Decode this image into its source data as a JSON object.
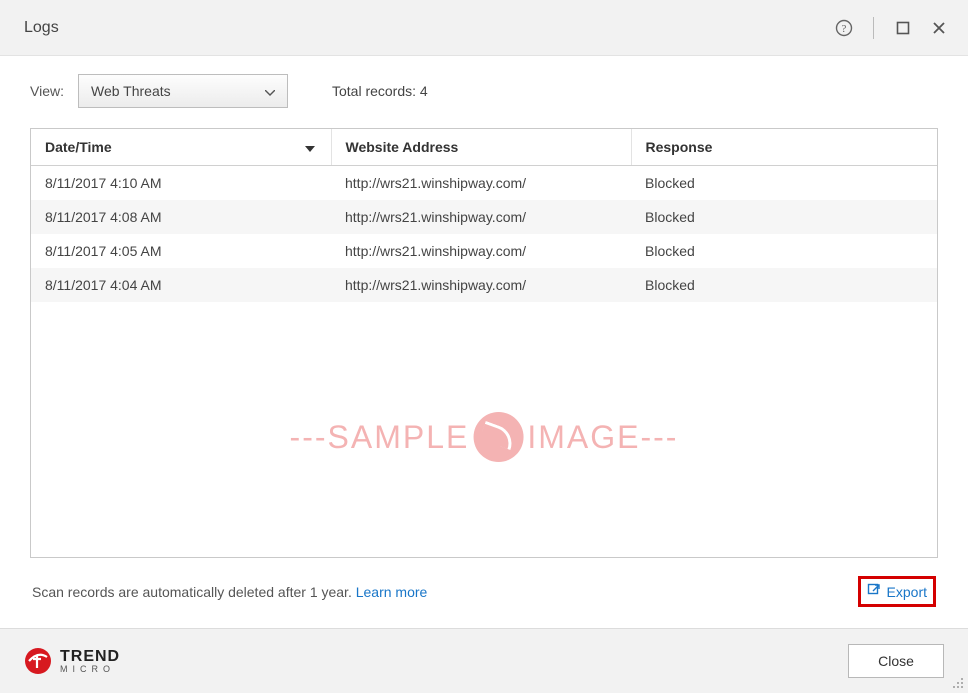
{
  "window": {
    "title": "Logs"
  },
  "view": {
    "label": "View:",
    "selected": "Web Threats",
    "total_label": "Total records:",
    "total_value": "4"
  },
  "columns": {
    "datetime": "Date/Time",
    "address": "Website Address",
    "response": "Response"
  },
  "rows": [
    {
      "datetime": "8/11/2017 4:10 AM",
      "address": "http://wrs21.winshipway.com/",
      "response": "Blocked"
    },
    {
      "datetime": "8/11/2017 4:08 AM",
      "address": "http://wrs21.winshipway.com/",
      "response": "Blocked"
    },
    {
      "datetime": "8/11/2017 4:05 AM",
      "address": "http://wrs21.winshipway.com/",
      "response": "Blocked"
    },
    {
      "datetime": "8/11/2017 4:04 AM",
      "address": "http://wrs21.winshipway.com/",
      "response": "Blocked"
    }
  ],
  "info": {
    "text": "Scan records are automatically deleted after 1 year.",
    "learn_more": "Learn more"
  },
  "export_label": "Export",
  "brand": {
    "name": "TREND",
    "sub": "MICRO"
  },
  "close_label": "Close",
  "watermark": {
    "left": "---SAMPLE",
    "right": "IMAGE---"
  }
}
